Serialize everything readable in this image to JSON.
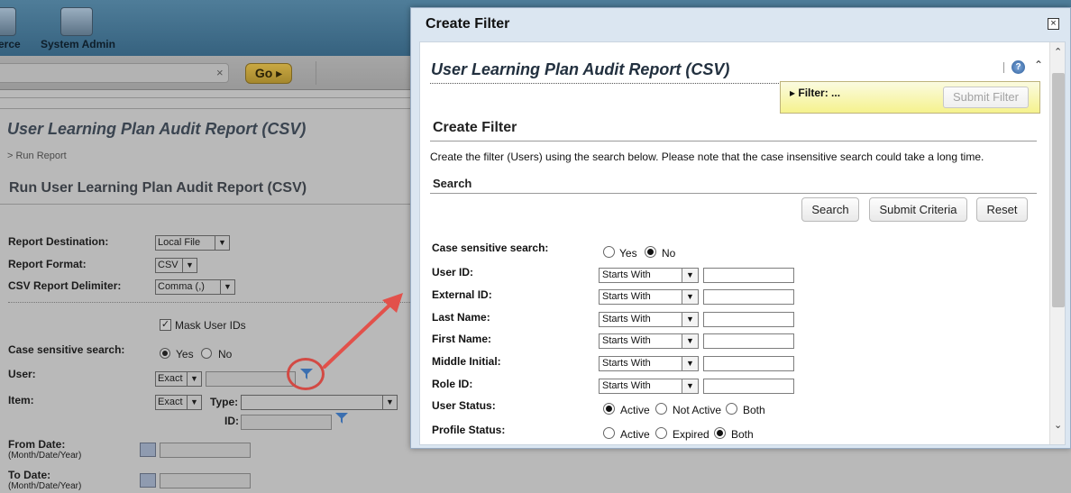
{
  "background": {
    "nav": {
      "commerce_label": "erce",
      "system_admin_label": "System Admin"
    },
    "search": {
      "clear": "×",
      "go_label": "Go ▸"
    },
    "page_title": "User Learning Plan Audit Report (CSV)",
    "breadcrumb": "> Run Report",
    "subtitle": "Run User Learning Plan Audit Report (CSV)",
    "form": {
      "report_destination": {
        "label": "Report Destination:",
        "value": "Local File"
      },
      "report_format": {
        "label": "Report Format:",
        "value": "CSV"
      },
      "csv_delimiter": {
        "label": "CSV Report Delimiter:",
        "value": "Comma (,)"
      },
      "mask_user_ids": {
        "label": "Mask User IDs",
        "checked": true
      },
      "case_sensitive": {
        "label": "Case sensitive search:",
        "yes": "Yes",
        "no": "No",
        "selected": "Yes"
      },
      "user": {
        "label": "User:",
        "match": "Exact"
      },
      "item": {
        "label": "Item:",
        "match": "Exact",
        "type_label": "Type:",
        "id_label": "ID:"
      },
      "from_date": {
        "label": "From Date:",
        "hint": "(Month/Date/Year)"
      },
      "to_date": {
        "label": "To Date:",
        "hint": "(Month/Date/Year)"
      }
    }
  },
  "dialog": {
    "title": "Create Filter",
    "close": "×",
    "report_title": "User Learning Plan Audit Report (CSV)",
    "help": "?",
    "filter_label": "▸ Filter: ...",
    "submit_filter_label": "Submit Filter",
    "section_create": "Create Filter",
    "description": "Create the filter (Users) using the search below. Please note that the case insensitive search could take a long time.",
    "section_search": "Search",
    "buttons": {
      "search": "Search",
      "submit_criteria": "Submit Criteria",
      "reset": "Reset"
    },
    "case_sensitive": {
      "label": "Case sensitive search:",
      "yes": "Yes",
      "no": "No",
      "selected": "No"
    },
    "fields": [
      {
        "label": "User ID:",
        "operator": "Starts With",
        "value": ""
      },
      {
        "label": "External ID:",
        "operator": "Starts With",
        "value": ""
      },
      {
        "label": "Last Name:",
        "operator": "Starts With",
        "value": ""
      },
      {
        "label": "First Name:",
        "operator": "Starts With",
        "value": ""
      },
      {
        "label": "Middle Initial:",
        "operator": "Starts With",
        "value": ""
      },
      {
        "label": "Role ID:",
        "operator": "Starts With",
        "value": ""
      }
    ],
    "user_status": {
      "label": "User Status:",
      "options": [
        "Active",
        "Not Active",
        "Both"
      ],
      "selected": "Active"
    },
    "profile_status": {
      "label": "Profile Status:",
      "options": [
        "Active",
        "Expired",
        "Both"
      ],
      "selected": "Both"
    }
  },
  "colors": {
    "annotation": "#d24a44",
    "dialog_bg": "#dbe6f1",
    "filter_yellow": "#f5f28d"
  }
}
